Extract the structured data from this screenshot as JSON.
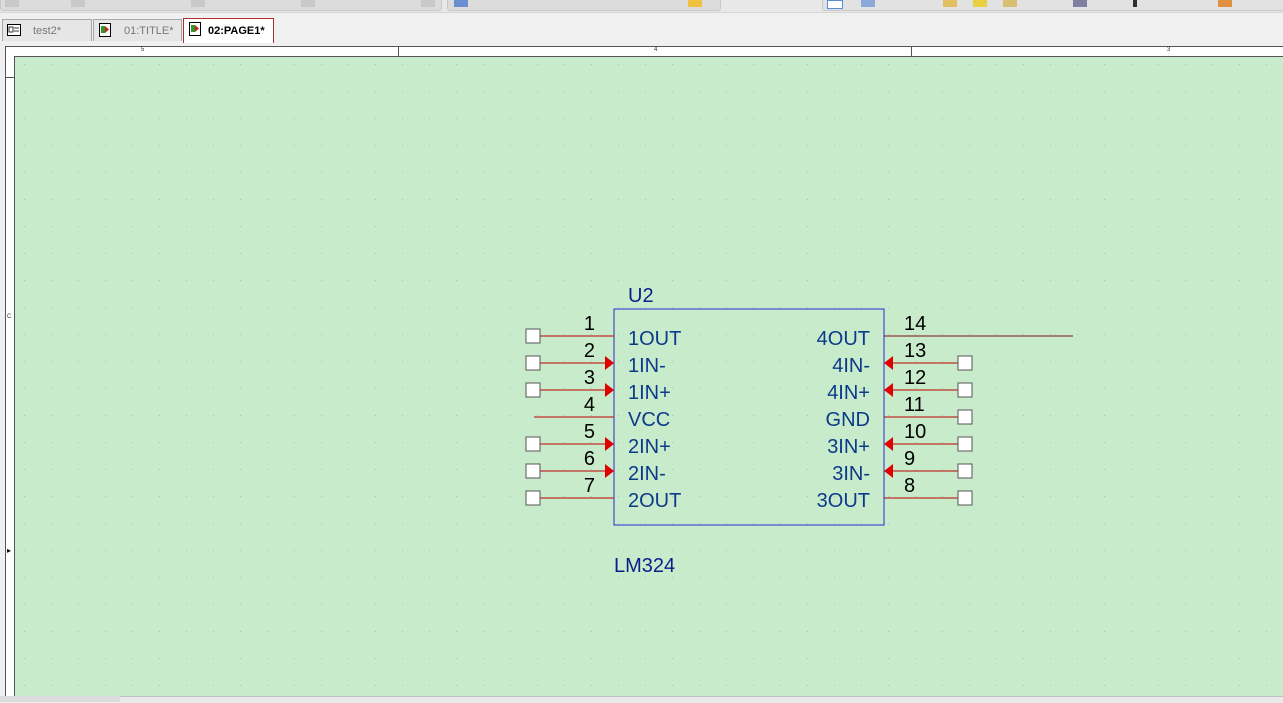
{
  "tabs": [
    {
      "label": "test2*",
      "icon": "schematic-project-icon",
      "active": false
    },
    {
      "label": "01:TITLE*",
      "icon": "schematic-page-icon",
      "active": false
    },
    {
      "label": "02:PAGE1*",
      "icon": "schematic-page-icon",
      "active": true
    }
  ],
  "ruler": {
    "top_labels": [
      "5",
      "4",
      "3"
    ],
    "left_labels": [
      "C"
    ]
  },
  "part": {
    "ref": "U2",
    "value": "LM324",
    "left_pins": [
      {
        "num": "1",
        "name": "1OUT"
      },
      {
        "num": "2",
        "name": "1IN-"
      },
      {
        "num": "3",
        "name": "1IN+"
      },
      {
        "num": "4",
        "name": "VCC"
      },
      {
        "num": "5",
        "name": "2IN+"
      },
      {
        "num": "6",
        "name": "2IN-"
      },
      {
        "num": "7",
        "name": "2OUT"
      }
    ],
    "right_pins": [
      {
        "num": "14",
        "name": "4OUT"
      },
      {
        "num": "13",
        "name": "4IN-"
      },
      {
        "num": "12",
        "name": "4IN+"
      },
      {
        "num": "11",
        "name": "GND"
      },
      {
        "num": "10",
        "name": "3IN+"
      },
      {
        "num": "9",
        "name": "3IN-"
      },
      {
        "num": "8",
        "name": "3OUT"
      }
    ]
  },
  "colors": {
    "sheet": "#c8ebcb",
    "body_outline": "#2a2ad0",
    "pin_line": "#c00000",
    "pin_arrow": "#e00000",
    "pin_name": "#0b3a8a",
    "pin_number": "#000000",
    "ref_text": "#0b1f8a"
  }
}
